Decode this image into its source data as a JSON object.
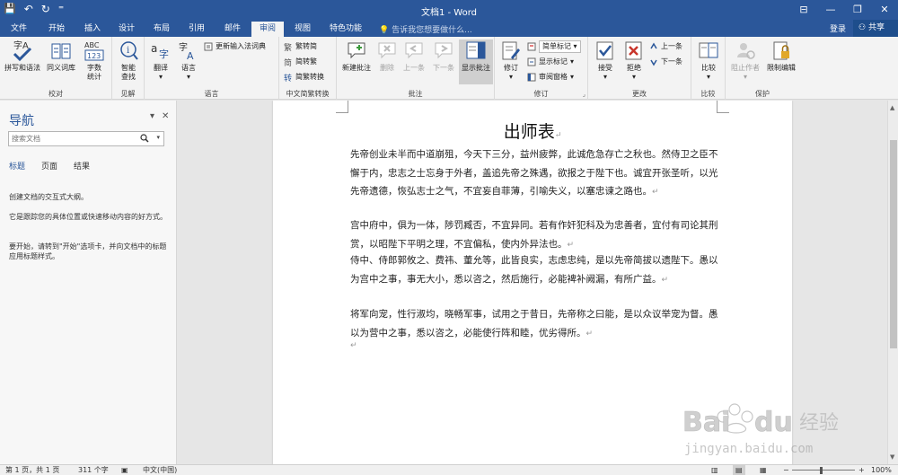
{
  "titlebar": {
    "title": "文档1 - Word",
    "minimize": "—",
    "restore": "❐",
    "close": "✕",
    "ribbon_opts": "⊟"
  },
  "qat": {
    "save": "💾",
    "undo": "↶",
    "redo": "↻",
    "customize": "⁼"
  },
  "tabs": [
    "文件",
    "开始",
    "插入",
    "设计",
    "布局",
    "引用",
    "邮件",
    "审阅",
    "视图",
    "特色功能"
  ],
  "active_tab": "审阅",
  "tell_me": {
    "icon": "💡",
    "placeholder": "告诉我您想要做什么..."
  },
  "account": {
    "login": "登录",
    "share": "共享"
  },
  "ribbon": {
    "groups": {
      "proofing": "校对",
      "insights": "见解",
      "language": "语言",
      "chinese_conversion": "中文简繁转换",
      "comments": "批注",
      "tracking": "修订",
      "changes": "更改",
      "compare": "比较",
      "protect": "保护"
    },
    "spelling": "拼写和语法",
    "thesaurus": "同义词库",
    "word_count_l1": "字数",
    "word_count_l2": "统计",
    "smart_lookup_l1": "智能",
    "smart_lookup_l2": "查找",
    "translate": "翻译",
    "language": "语言",
    "update_ime": "更新输入法词典",
    "trad_to_simp": "繁转简",
    "simp_to_trad": "简转繁",
    "conversion": "简繁转换",
    "new_comment": "新建批注",
    "delete": "删除",
    "previous": "上一条",
    "next": "下一条",
    "show_comments": "显示批注",
    "track_changes": "修订",
    "markup_mode": "简单标记",
    "show_markup": "显示标记",
    "reviewing_pane": "审阅窗格",
    "accept": "接受",
    "reject": "拒绝",
    "prev_change": "上一条",
    "next_change": "下一条",
    "compare": "比较",
    "block_authors": "阻止作者",
    "restrict_editing": "限制编辑",
    "dropdown": "▾"
  },
  "nav": {
    "title": "导航",
    "search_placeholder": "搜索文档",
    "tabs": [
      "标题",
      "页面",
      "结果"
    ],
    "text1": "创建文档的交互式大纲。",
    "text2": "它是跟踪您的具体位置或快速移动内容的好方式。",
    "text3": "要开始，请转到\"开始\"选项卡，并向文档中的标题应用标题样式。"
  },
  "document": {
    "title": "出师表",
    "paragraphs": [
      "先帝创业未半而中道崩殂，今天下三分，益州疲弊，此诚危急存亡之秋也。然侍卫之臣不懈于内，忠志之士忘身于外者，盖追先帝之殊遇，欲报之于陛下也。诚宜开张圣听，以光先帝遗德，恢弘志士之气，不宜妄自菲薄，引喻失义，以塞忠谏之路也。",
      "宫中府中，俱为一体，陟罚臧否，不宜异同。若有作奸犯科及为忠善者，宜付有司论其刑赏，以昭陛下平明之理，不宜偏私，使内外异法也。",
      "侍中、侍郎郭攸之、费祎、董允等，此皆良实，志虑忠纯，是以先帝简拔以遗陛下。愚以为宫中之事，事无大小，悉以咨之，然后施行，必能裨补阙漏，有所广益。",
      "将军向宠，性行淑均，晓畅军事，试用之于昔日，先帝称之曰能，是以众议举宠为督。愚以为营中之事，悉以咨之，必能使行阵和睦，优劣得所。"
    ],
    "para_mark": "↵"
  },
  "status": {
    "page": "第 1 页，共 1 页",
    "words": "311 个字",
    "language": "中文(中国)",
    "zoom": "100%",
    "zoom_minus": "−",
    "zoom_plus": "+"
  },
  "watermark": {
    "brand": "Bai",
    "brand_suffix": "经验",
    "url": "jingyan.baidu.com"
  },
  "colors": {
    "accent": "#2b579a",
    "ribbon_bg": "#f3f3f3",
    "canvas_bg": "#e6e6e6"
  }
}
